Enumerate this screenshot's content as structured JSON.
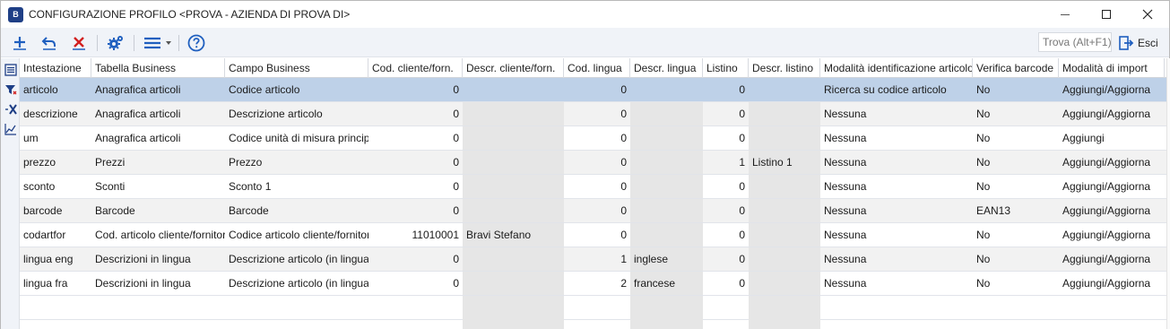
{
  "window": {
    "title": "CONFIGURAZIONE PROFILO <PROVA - AZIENDA DI PROVA  DI>",
    "app_icon_text": "B"
  },
  "toolbar": {
    "search_placeholder": "Trova (Alt+F1)",
    "exit_label": "Esci",
    "icons": [
      "add-icon",
      "undo-icon",
      "delete-icon",
      "settings-icon",
      "menu-icon",
      "help-icon"
    ]
  },
  "sidebar": {
    "icons": [
      "list-view-icon",
      "filter-icon",
      "clear-filter-icon",
      "chart-icon"
    ]
  },
  "grid": {
    "columns": [
      "Intestazione",
      "Tabella Business",
      "Campo Business",
      "Cod. cliente/forn.",
      "Descr. cliente/forn.",
      "Cod. lingua",
      "Descr. lingua",
      "Listino",
      "Descr. listino",
      "Modalità identificazione articolo",
      "Verifica barcode",
      "Modalità di import"
    ],
    "rows": [
      [
        "articolo",
        "Anagrafica articoli",
        "Codice articolo",
        "0",
        "",
        "0",
        "",
        "0",
        "",
        "Ricerca su codice articolo",
        "No",
        "Aggiungi/Aggiorna"
      ],
      [
        "descrizione",
        "Anagrafica articoli",
        "Descrizione articolo",
        "0",
        "",
        "0",
        "",
        "0",
        "",
        "Nessuna",
        "No",
        "Aggiungi/Aggiorna"
      ],
      [
        "um",
        "Anagrafica articoli",
        "Codice unità di misura principale",
        "0",
        "",
        "0",
        "",
        "0",
        "",
        "Nessuna",
        "No",
        "Aggiungi"
      ],
      [
        "prezzo",
        "Prezzi",
        "Prezzo",
        "0",
        "",
        "0",
        "",
        "1",
        "Listino 1",
        "Nessuna",
        "No",
        "Aggiungi/Aggiorna"
      ],
      [
        "sconto",
        "Sconti",
        "Sconto 1",
        "0",
        "",
        "0",
        "",
        "0",
        "",
        "Nessuna",
        "No",
        "Aggiungi/Aggiorna"
      ],
      [
        "barcode",
        "Barcode",
        "Barcode",
        "0",
        "",
        "0",
        "",
        "0",
        "",
        "Nessuna",
        "EAN13",
        "Aggiungi/Aggiorna"
      ],
      [
        "codartfor",
        "Cod. articolo cliente/fornitori",
        "Codice articolo cliente/fornitore",
        "11010001",
        "Bravi Stefano",
        "0",
        "",
        "0",
        "",
        "Nessuna",
        "No",
        "Aggiungi/Aggiorna"
      ],
      [
        "lingua eng",
        "Descrizioni in lingua",
        "Descrizione articolo (in lingua)",
        "0",
        "",
        "1",
        "inglese",
        "0",
        "",
        "Nessuna",
        "No",
        "Aggiungi/Aggiorna"
      ],
      [
        "lingua fra",
        "Descrizioni in lingua",
        "Descrizione articolo (in lingua)",
        "0",
        "",
        "2",
        "francese",
        "0",
        "",
        "Nessuna",
        "No",
        "Aggiungi/Aggiorna"
      ]
    ],
    "selected_row": 0
  },
  "colors": {
    "selection": "#bed1e8",
    "alt_row": "#f2f2f2",
    "readonly_cell": "#e6e6e6",
    "toolbar_bg": "#f0f3f8",
    "accent_blue": "#1f5fbf",
    "delete_red": "#d21f1f"
  }
}
